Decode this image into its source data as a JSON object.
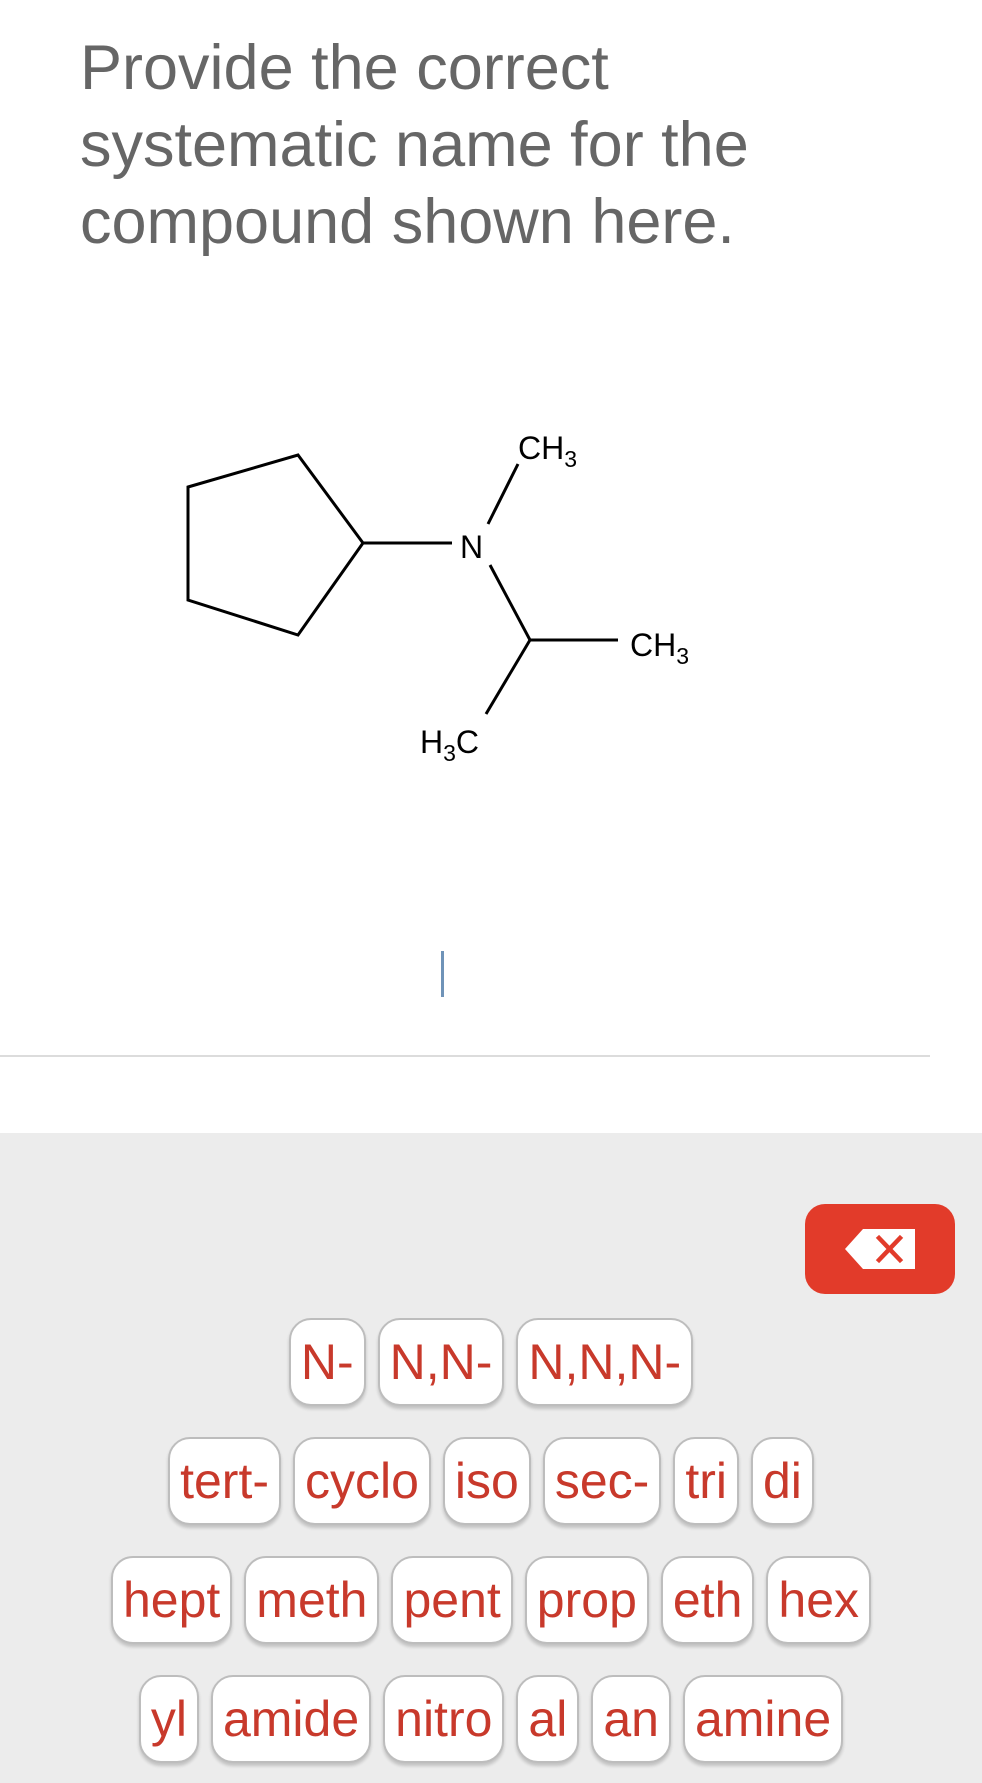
{
  "question": "Provide the correct systematic name for the compound shown here.",
  "molecule": {
    "labels": {
      "n": "N",
      "ch3_top": "CH",
      "ch3_top_sub": "3",
      "ch3_right": "CH",
      "ch3_right_sub": "3",
      "h3c_h": "H",
      "h3c_sub": "3",
      "h3c_c": "C"
    }
  },
  "answer": {
    "value": ""
  },
  "keyboard": {
    "backspace_icon": "backspace-icon",
    "accent_color": "#e23b2a",
    "key_text_color": "#c8392b",
    "rows": [
      [
        "N-",
        "N,N-",
        "N,N,N-"
      ],
      [
        "tert-",
        "cyclo",
        "iso",
        "sec-",
        "tri",
        "di"
      ],
      [
        "hept",
        "meth",
        "pent",
        "prop",
        "eth",
        "hex"
      ],
      [
        "yl",
        "amide",
        "nitro",
        "al",
        "an",
        "amine"
      ]
    ]
  }
}
